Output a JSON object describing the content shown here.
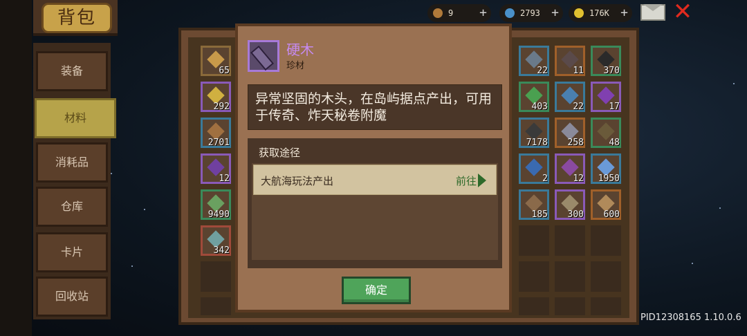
{
  "title": "背包",
  "sidebar": {
    "items": [
      {
        "label": "装备",
        "active": false
      },
      {
        "label": "材料",
        "active": true
      },
      {
        "label": "消耗品",
        "active": false
      },
      {
        "label": "仓库",
        "active": false
      },
      {
        "label": "卡片",
        "active": false
      },
      {
        "label": "回收站",
        "active": false
      }
    ]
  },
  "resources": [
    {
      "icon": "fish-icon",
      "value": "9",
      "color": "#b07a3a"
    },
    {
      "icon": "gem-icon",
      "value": "2793",
      "color": "#4a90c8"
    },
    {
      "icon": "coin-icon",
      "value": "176K",
      "color": "#e0c030"
    }
  ],
  "inventory": {
    "left_column": [
      "65",
      "292",
      "2701",
      "12",
      "9490",
      "342"
    ],
    "right_rows": [
      [
        "22",
        "11",
        "370"
      ],
      [
        "403",
        "22",
        "17"
      ],
      [
        "7178",
        "258",
        "48"
      ],
      [
        "2",
        "12",
        "1950"
      ],
      [
        "185",
        "300",
        "600"
      ]
    ]
  },
  "dialog": {
    "item_name": "硬木",
    "item_type": "珍材",
    "description": "异常坚固的木头，在岛屿据点产出，可用于传奇、炸天秘卷附魔",
    "source_title": "获取途径",
    "sources": [
      {
        "label": "大航海玩法产出",
        "action": "前往"
      }
    ],
    "confirm_label": "确定"
  },
  "footer": {
    "pid": "PID12308165 1.10.0.6"
  },
  "colors": {
    "item_name": "#c58af0",
    "active_tab": "#b6a34a",
    "confirm": "#4fa45a",
    "close": "#e02a1e"
  }
}
